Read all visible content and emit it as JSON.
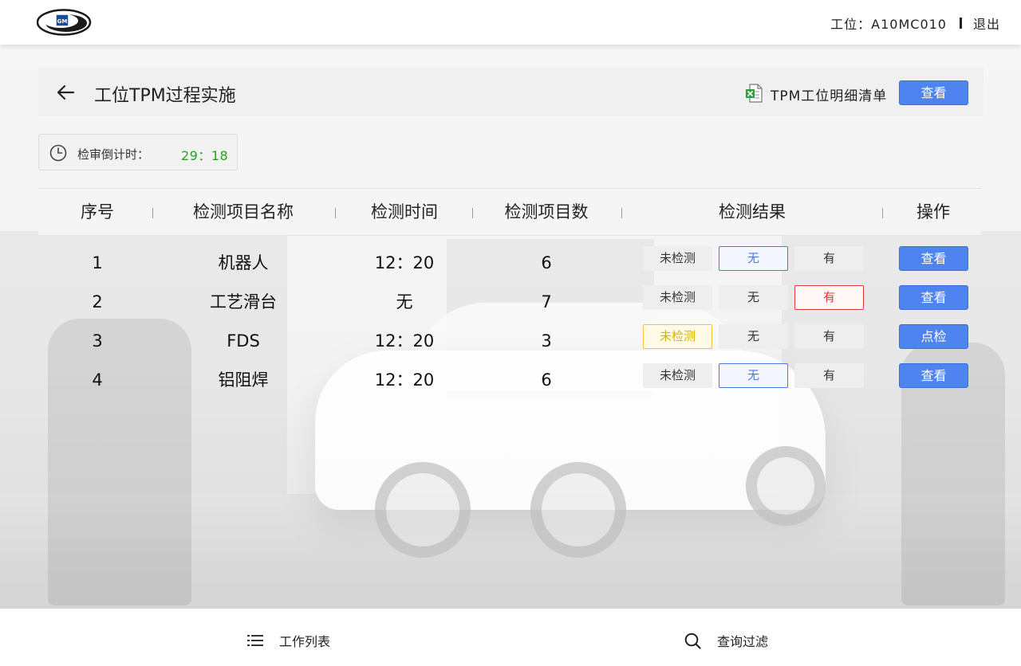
{
  "header": {
    "workstation": "工位：A10MC010",
    "logout_label": "退出"
  },
  "title_bar": {
    "title": "工位TPM过程实施",
    "detail_link": "TPM工位明细清单",
    "view_button": "查看"
  },
  "countdown": {
    "label": "检审倒计时：",
    "value": "29：18"
  },
  "table": {
    "columns": [
      "序号",
      "检测项目名称",
      "检测时间",
      "检测项目数",
      "检测结果",
      "操作"
    ],
    "rows": [
      {
        "index": "1",
        "name": "机器人",
        "time": "12：20",
        "count": "6",
        "results": [
          "未检测",
          "无",
          "有"
        ],
        "selected": "无",
        "action": "查看"
      },
      {
        "index": "2",
        "name": "工艺滑台",
        "time": "无",
        "count": "7",
        "results": [
          "未检测",
          "无",
          "有"
        ],
        "selected": "有",
        "action": "查看"
      },
      {
        "index": "3",
        "name": "FDS",
        "time": "12：20",
        "count": "3",
        "results": [
          "未检测",
          "无",
          "有"
        ],
        "selected": "未检测",
        "action": "点检"
      },
      {
        "index": "4",
        "name": "铝阻焊",
        "time": "12：20",
        "count": "6",
        "results": [
          "未检测",
          "无",
          "有"
        ],
        "selected": "无",
        "action": "查看"
      }
    ]
  },
  "bottom_nav": {
    "work_list": "工作列表",
    "query_filter": "查询过滤"
  },
  "icons": {
    "logo": "gm-logo",
    "back": "arrow-left-icon",
    "excel": "excel-file-icon",
    "clock": "clock-icon",
    "list": "list-icon",
    "search": "search-icon"
  },
  "colors": {
    "primary_button": "#4f83f0",
    "countdown_value": "#23a31f",
    "selected_none": "#4a78e0",
    "selected_yes": "#e23a3a",
    "selected_unchecked": "#f1c232"
  }
}
